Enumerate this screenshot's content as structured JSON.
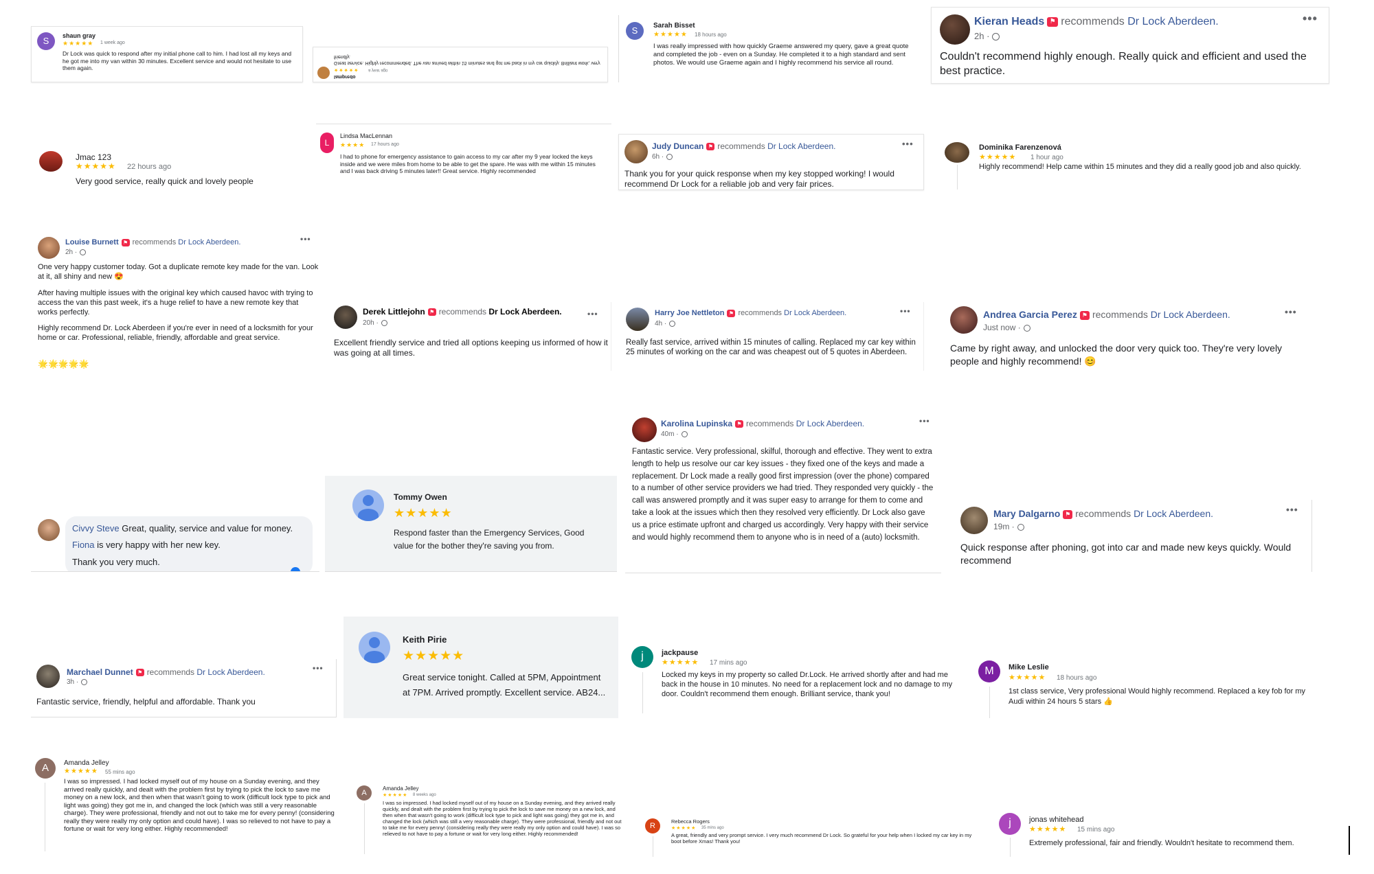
{
  "reviews": {
    "shaun": {
      "name": "shaun gray",
      "initial": "S",
      "stars": "★★★★★",
      "time": "1 week ago",
      "text": "Dr Lock was quick to respond after my initial phone call to him. I had lost all my keys and he got me into my van within 30 minutes. Excellent service and would not hesitate to use them again."
    },
    "mirrored": {
      "name": "lampredo",
      "stars": "★★★★★",
      "time": "a year ago",
      "text": "Great service. Highly recommended. The van arrived within 15 minutes and got me back in my car quickly. Brilliant work, very friendly."
    },
    "sarah": {
      "name": "Sarah Bisset",
      "initial": "S",
      "stars": "★★★★★",
      "time": "18 hours ago",
      "text": "I was really impressed with how quickly Graeme answered my query, gave a great quote and completed the job - even on a Sunday. He completed it to a high standard and sent photos. We would use Graeme again and I highly recommend his service all round."
    },
    "kieran": {
      "name": "Kieran Heads",
      "recommends": "recommends",
      "page": "Dr Lock Aberdeen.",
      "meta": "2h ·",
      "text": "Couldn't recommend highly enough. Really quick and efficient and used the best practice."
    },
    "jmac": {
      "name": "Jmac 123",
      "stars": "★★★★★",
      "time": "22 hours ago",
      "text": "Very good service, really quick and lovely people"
    },
    "lindsa": {
      "name": "Lindsa MacLennan",
      "initial": "L",
      "stars": "★★★★",
      "time": "17 hours ago",
      "text": "I had to phone for emergency assistance to gain access to my car after my 9 year locked the keys inside and we were miles from home to be able to get the spare. He was with me within 15 minutes and I was back driving 5 minutes later!! Great service. Highly recommended"
    },
    "judy": {
      "name": "Judy Duncan",
      "recommends": "recommends",
      "page": "Dr Lock Aberdeen.",
      "meta": "6h ·",
      "text": "Thank you for your quick response when my key stopped working! I would recommend Dr Lock for a reliable job and very fair prices."
    },
    "dominika": {
      "name": "Dominika Farenzenová",
      "stars": "★★★★★",
      "time": "1 hour ago",
      "text": "Highly recommend! Help came within 15 minutes and they did a really good job and also quickly."
    },
    "louise": {
      "name": "Louise Burnett",
      "recommends": "recommends",
      "page": "Dr Lock Aberdeen.",
      "meta": "2h ·",
      "p1": "One very happy customer today. Got a duplicate remote key made for the van. Look at it, all shiny and new 😍",
      "p2": "After having multiple issues with the original key which caused havoc with trying to access the van this past week, it's a huge relief to have a new remote key that works perfectly.",
      "p3": "Highly recommend Dr. Lock Aberdeen if you're ever in need of a locksmith for your home or car. Professional, reliable, friendly, affordable and great service.",
      "emojis": "🌟🌟🌟🌟🌟"
    },
    "derek": {
      "name": "Derek Littlejohn",
      "recommends": "recommends",
      "page": "Dr Lock Aberdeen.",
      "meta": "20h ·",
      "text": "Excellent friendly service and tried all options keeping us informed of how it was going at all times."
    },
    "harry": {
      "name": "Harry Joe Nettleton",
      "recommends": "recommends",
      "page": "Dr Lock Aberdeen.",
      "meta": "4h ·",
      "text": "Really fast service, arrived within 15 minutes of calling. Replaced my car key within 25 minutes of working on the car and was cheapest out of 5 quotes in Aberdeen."
    },
    "andrea": {
      "name": "Andrea Garcia Perez",
      "recommends": "recommends",
      "page": "Dr Lock Aberdeen.",
      "meta": "Just now ·",
      "text": "Came by right away, and unlocked the door very quick too. They're very lovely people and highly recommend! 😊"
    },
    "karolina": {
      "name": "Karolina Lupinska",
      "recommends": "recommends",
      "page": "Dr Lock Aberdeen.",
      "meta": "40m ·",
      "text": "Fantastic service. Very professional, skilful, thorough and effective. They went to extra length to help us resolve our car key issues - they fixed one of the keys and made a replacement. Dr Lock made a really good first impression (over the phone) compared to a number of other service providers we had tried. They responded very quickly - the call was answered promptly and it was super easy to arrange for them to come and take a look at the issues which then they resolved very efficiently. Dr Lock also gave us a price estimate upfront and charged us accordingly. Very happy with their service and would highly recommend them to anyone who is in need of a (auto) locksmith."
    },
    "civvy": {
      "name": "Civvy Steve",
      "text": "Great, quality, service and value for money.",
      "mention": "Fiona",
      "text2": "is very happy with her new key.",
      "text3": "Thank you very much."
    },
    "tommy": {
      "name": "Tommy Owen",
      "stars": "★★★★★",
      "text": "Respond faster than the Emergency Services, Good value for the bother they're saving you from."
    },
    "mary": {
      "name": "Mary Dalgarno",
      "recommends": "recommends",
      "page": "Dr Lock Aberdeen.",
      "meta": "19m ·",
      "text": "Quick response after phoning, got into car and made new keys quickly. Would recommend"
    },
    "marchael": {
      "name": "Marchael Dunnet",
      "recommends": "recommends",
      "page": "Dr Lock Aberdeen.",
      "meta": "3h ·",
      "text": "Fantastic service, friendly, helpful and affordable. Thank you"
    },
    "keith": {
      "name": "Keith Pirie",
      "stars": "★★★★★",
      "text": "Great service tonight. Called at 5PM, Appointment at 7PM. Arrived promptly. Excellent service. AB24..."
    },
    "jackpause": {
      "name": "jackpause",
      "initial": "j",
      "stars": "★★★★★",
      "time": "17 mins ago",
      "text": "Locked my keys in my property so called Dr.Lock. He arrived shortly after and had me back in the house in 10 minutes. No need for a replacement lock and no damage to my door. Couldn't recommend them enough. Brilliant service, thank you!"
    },
    "mike": {
      "name": "Mike Leslie",
      "initial": "M",
      "stars": "★★★★★",
      "time": "18 hours ago",
      "text": "1st class service, Very professional Would highly recommend. Replaced a key fob for my Audi within 24 hours 5 stars 👍"
    },
    "amanda1": {
      "name": "Amanda Jelley",
      "initial": "A",
      "stars": "★★★★★",
      "time": "55 mins ago",
      "text": "I was so impressed. I had locked myself out of my house on a Sunday evening, and they arrived really quickly, and dealt with the problem first by trying to pick the lock to save me money on a new lock, and then when that wasn't going to work (difficult lock type to pick and light was going) they got me in, and changed the lock (which was still a very reasonable charge). They were professional, friendly and not out to take me for every penny! (considering really they were really my only option and could have). I was so relieved to not have to pay a fortune or wait for very long either. Highly recommended!"
    },
    "amanda2": {
      "name": "Amanda Jelley",
      "initial": "A",
      "stars": "★★★★★",
      "time": "8 weeks ago",
      "text": "I was so impressed. I had locked myself out of my house on a Sunday evening, and they arrived really quickly, and dealt with the problem first by trying to pick the lock to save me money on a new lock, and then when that wasn't going to work (difficult lock type to pick and light was going) they got me in, and changed the lock (which was still a very reasonable charge). They were professional, friendly and not out to take me for every penny! (considering really they were really my only option and could have). I was so relieved to not have to pay a fortune or wait for very long either. Highly recommended!"
    },
    "rebecca": {
      "name": "Rebecca Rogers",
      "initial": "R",
      "stars": "★★★★★",
      "time": "35 mins ago",
      "text": "A great, friendly and very prompt service. I very much recommend Dr Lock. So grateful for your help when I locked my car key in my boot before Xmas! Thank you!"
    },
    "jonas": {
      "name": "jonas whitehead",
      "initial": "j",
      "stars": "★★★★★",
      "time": "15 mins ago",
      "text": "Extremely professional, fair and friendly. Wouldn't hesitate to recommend them."
    }
  },
  "colors": {
    "fb_blue": "#385898",
    "star_yellow": "#fbbc04",
    "rec_red": "#f02849",
    "purple": "#7e57c2",
    "teal": "#00897b",
    "brown": "#8d6e63",
    "magenta": "#ab47bc",
    "orange": "#e64a19"
  }
}
